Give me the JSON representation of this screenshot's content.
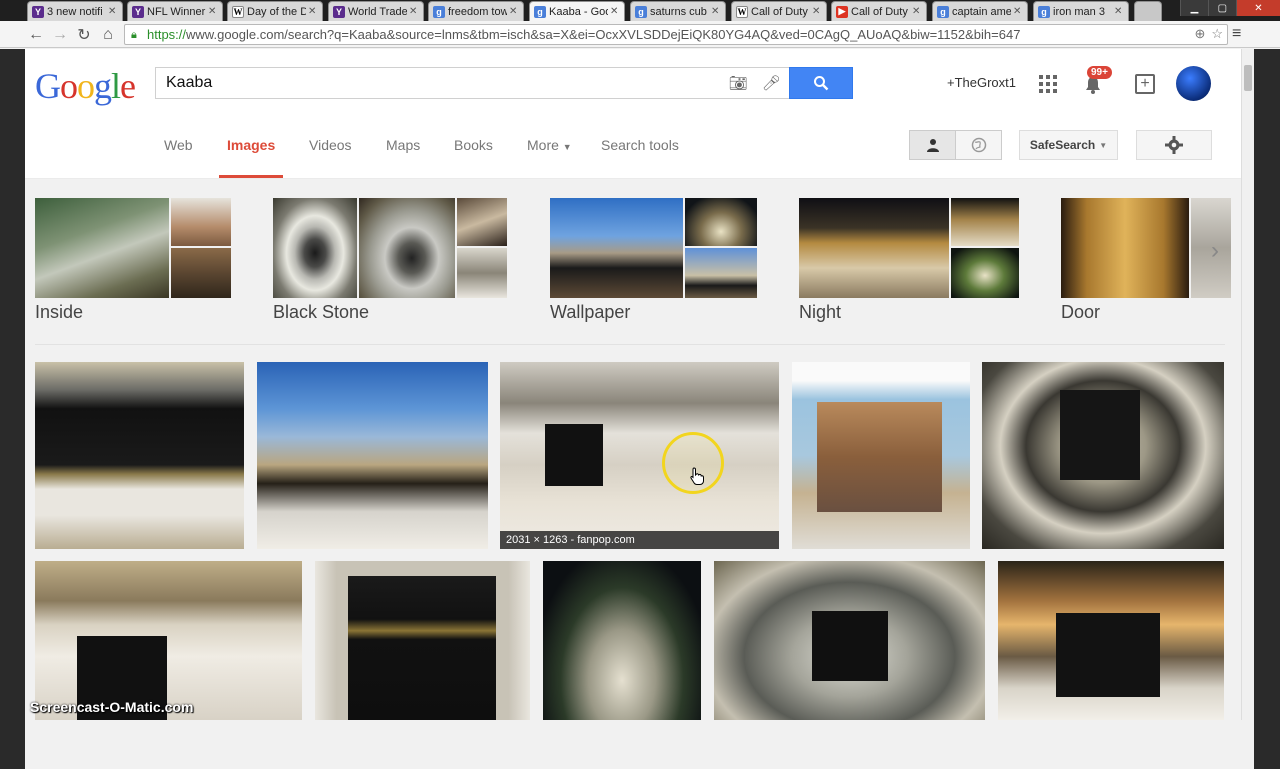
{
  "browser": {
    "tabs": [
      {
        "icon": "yahoo-favicon",
        "label": "3 new notifi"
      },
      {
        "icon": "yahoo-favicon",
        "label": "NFL Winner"
      },
      {
        "icon": "wikipedia-favicon",
        "label": "Day of the D"
      },
      {
        "icon": "yahoo-favicon",
        "label": "World Trade"
      },
      {
        "icon": "google-favicon",
        "label": "freedom tow"
      },
      {
        "icon": "google-favicon",
        "label": "Kaaba - Goo"
      },
      {
        "icon": "google-favicon",
        "label": "saturns cub"
      },
      {
        "icon": "wikipedia-favicon",
        "label": "Call of Duty"
      },
      {
        "icon": "youtube-favicon",
        "label": "Call of Duty"
      },
      {
        "icon": "google-favicon",
        "label": "captain ame"
      },
      {
        "icon": "google-favicon",
        "label": "iron man 3"
      }
    ],
    "url_https": "https://",
    "url_rest": "www.google.com/search?q=Kaaba&source=lnms&tbm=isch&sa=X&ei=OcxXVLSDDejEiQK80YG4AQ&ved=0CAgQ_AUoAQ&biw=1152&bih=647"
  },
  "header": {
    "logo_letters": [
      "G",
      "o",
      "o",
      "g",
      "l",
      "e"
    ],
    "query": "Kaaba",
    "user": "+TheGroxt1",
    "notifications": "99+"
  },
  "search_tabs": [
    "Web",
    "Images",
    "Videos",
    "Maps",
    "Books",
    "More",
    "Search tools"
  ],
  "safesearch_label": "SafeSearch",
  "related": [
    "Inside",
    "Black Stone",
    "Wallpaper",
    "Night",
    "Door"
  ],
  "hover_info": "2031 × 1263 - fanpop.com",
  "watermark": "Screencast-O-Matic.com",
  "colors": {
    "accent": "#dd4b39",
    "search_blue": "#4285f4",
    "https_green": "#2a8f2a"
  }
}
